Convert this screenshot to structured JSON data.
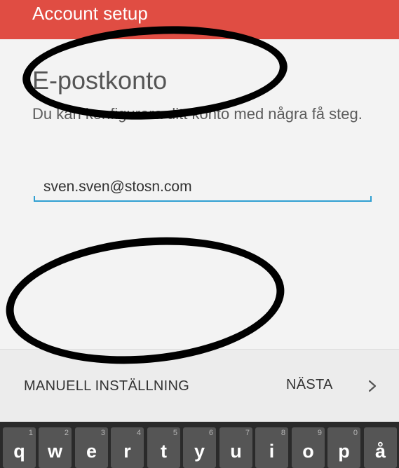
{
  "appbar": {
    "title": "Account setup",
    "color": "#e04d43"
  },
  "main": {
    "heading": "E-postkonto",
    "description": "Du kan konfigurera ditt konto med några få steg.",
    "email_value": "sven.sven@stosn.com",
    "accent_color": "#2f9fd1"
  },
  "footer": {
    "manual_label": "MANUELL INSTÄLLNING",
    "next_label": "NÄSTA",
    "next_icon": "chevron-right-icon"
  },
  "keyboard": {
    "keys": [
      {
        "num": "1",
        "letter": "q"
      },
      {
        "num": "2",
        "letter": "w"
      },
      {
        "num": "3",
        "letter": "e"
      },
      {
        "num": "4",
        "letter": "r"
      },
      {
        "num": "5",
        "letter": "t"
      },
      {
        "num": "6",
        "letter": "y"
      },
      {
        "num": "7",
        "letter": "u"
      },
      {
        "num": "8",
        "letter": "i"
      },
      {
        "num": "9",
        "letter": "o"
      },
      {
        "num": "0",
        "letter": "p"
      },
      {
        "num": "",
        "letter": "å"
      }
    ]
  }
}
